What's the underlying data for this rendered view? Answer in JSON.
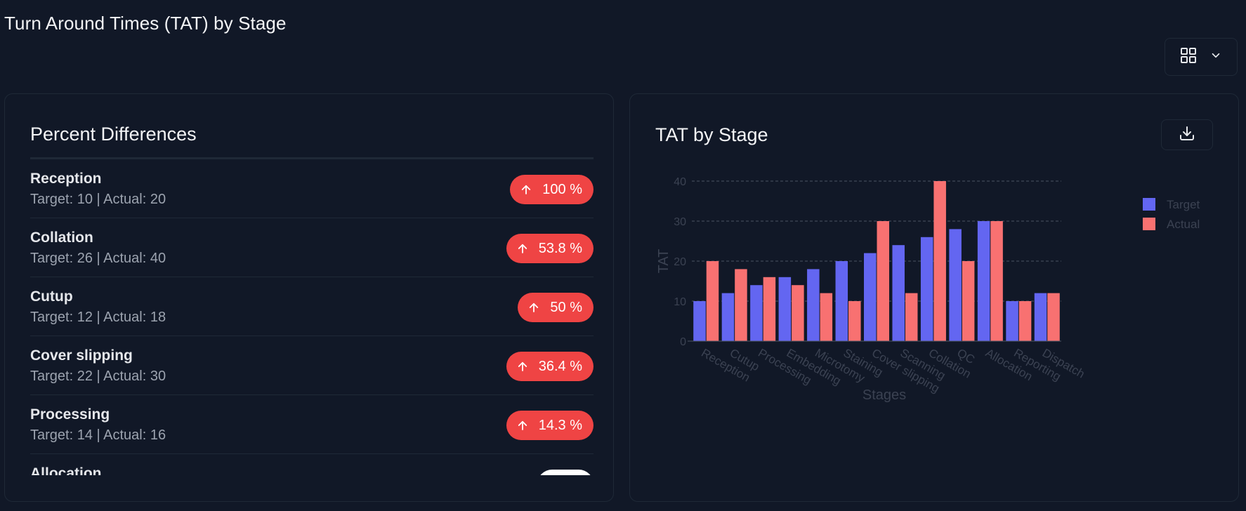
{
  "page": {
    "title": "Turn Around Times (TAT) by Stage"
  },
  "toolbar": {
    "view_toggle_icon": "grid-icon",
    "dropdown_icon": "chevron-down-icon"
  },
  "percent_panel": {
    "title": "Percent Differences",
    "items": [
      {
        "name": "Reception",
        "detail": "Target: 10 | Actual: 20",
        "badge": "100 %"
      },
      {
        "name": "Collation",
        "detail": "Target: 26 | Actual: 40",
        "badge": "53.8 %"
      },
      {
        "name": "Cutup",
        "detail": "Target: 12 | Actual: 18",
        "badge": "50 %"
      },
      {
        "name": "Cover slipping",
        "detail": "Target: 22 | Actual: 30",
        "badge": "36.4 %"
      },
      {
        "name": "Processing",
        "detail": "Target: 14 | Actual: 16",
        "badge": "14.3 %"
      },
      {
        "name": "Allocation",
        "detail": "",
        "badge": ""
      }
    ],
    "badge_color": "#ef4444",
    "badge_icon": "arrow-up-icon"
  },
  "chart_panel": {
    "title": "TAT by Stage",
    "download_icon": "download-icon"
  },
  "chart_data": {
    "type": "bar",
    "categories": [
      "Reception",
      "Cutup",
      "Processing",
      "Embedding",
      "Microtomy",
      "Staining",
      "Cover slipping",
      "Scanning",
      "Collation",
      "QC",
      "Allocation",
      "Reporting",
      "Dispatch"
    ],
    "series": [
      {
        "name": "Target",
        "values": [
          10,
          12,
          14,
          16,
          18,
          20,
          22,
          24,
          26,
          28,
          30,
          10,
          12
        ],
        "color": "#6366f1"
      },
      {
        "name": "Actual",
        "values": [
          20,
          18,
          16,
          14,
          12,
          10,
          30,
          12,
          40,
          20,
          30,
          10,
          12
        ],
        "color": "#f87171"
      }
    ],
    "xlabel": "Stages",
    "ylabel": "TAT",
    "ylim": [
      0,
      40
    ],
    "yticks": [
      "0",
      "10",
      "20",
      "30",
      "40"
    ],
    "grid": true,
    "legend": "top-right"
  }
}
